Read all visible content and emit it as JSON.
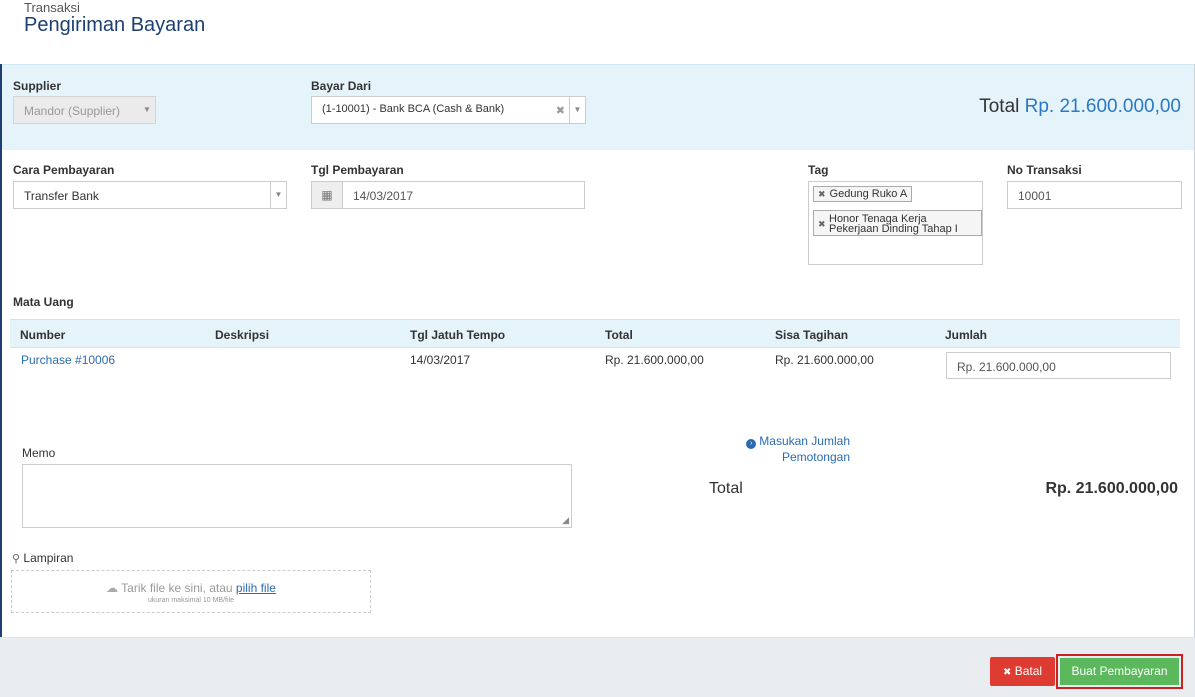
{
  "header": {
    "breadcrumb": "Transaksi",
    "title": "Pengiriman Bayaran"
  },
  "form": {
    "supplier": {
      "label": "Supplier",
      "value": "Mandor (Supplier)"
    },
    "bayar_dari": {
      "label": "Bayar Dari",
      "value": "(1-10001) - Bank BCA (Cash & Bank)"
    },
    "total_header": {
      "label": "Total",
      "value": "Rp. 21.600.000,00"
    },
    "cara_pembayaran": {
      "label": "Cara Pembayaran",
      "value": "Transfer Bank"
    },
    "tgl_pembayaran": {
      "label": "Tgl Pembayaran",
      "value": "14/03/2017"
    },
    "tag": {
      "label": "Tag",
      "chips": [
        "Gedung Ruko A",
        "Honor Tenaga Kerja",
        "Pekerjaan Dinding Tahap I"
      ]
    },
    "no_transaksi": {
      "label": "No Transaksi",
      "value": "10001"
    },
    "mata_uang": {
      "label": "Mata Uang"
    }
  },
  "table": {
    "headers": [
      "Number",
      "Deskripsi",
      "Tgl Jatuh Tempo",
      "Total",
      "Sisa Tagihan",
      "Jumlah"
    ],
    "rows": [
      {
        "number": "Purchase #10006",
        "deskripsi": "",
        "due": "14/03/2017",
        "total": "Rp. 21.600.000,00",
        "sisa": "Rp. 21.600.000,00",
        "jumlah": "Rp. 21.600.000,00"
      }
    ]
  },
  "memo": {
    "label": "Memo"
  },
  "deduction": {
    "line1": "Masukan Jumlah",
    "line2": "Pemotongan"
  },
  "summary": {
    "label": "Total",
    "value": "Rp. 21.600.000,00"
  },
  "attachment": {
    "label": "Lampiran",
    "drop_text": "Tarik file ke sini, atau",
    "drop_link": "pilih file",
    "size_hint": "ukuran maksimal 10 MB/file"
  },
  "actions": {
    "cancel": "Batal",
    "submit": "Buat Pembayaran"
  },
  "icons": {
    "clear": "×",
    "arrow": "▼",
    "calendar": "▦",
    "paperclip": "📎",
    "cloud": "☁",
    "chevron": "›"
  },
  "colors": {
    "title": "#1d3f72",
    "accent": "#2b78c5",
    "panel": "#e5f3fb",
    "danger": "#de3c33",
    "success": "#5cb85c"
  }
}
